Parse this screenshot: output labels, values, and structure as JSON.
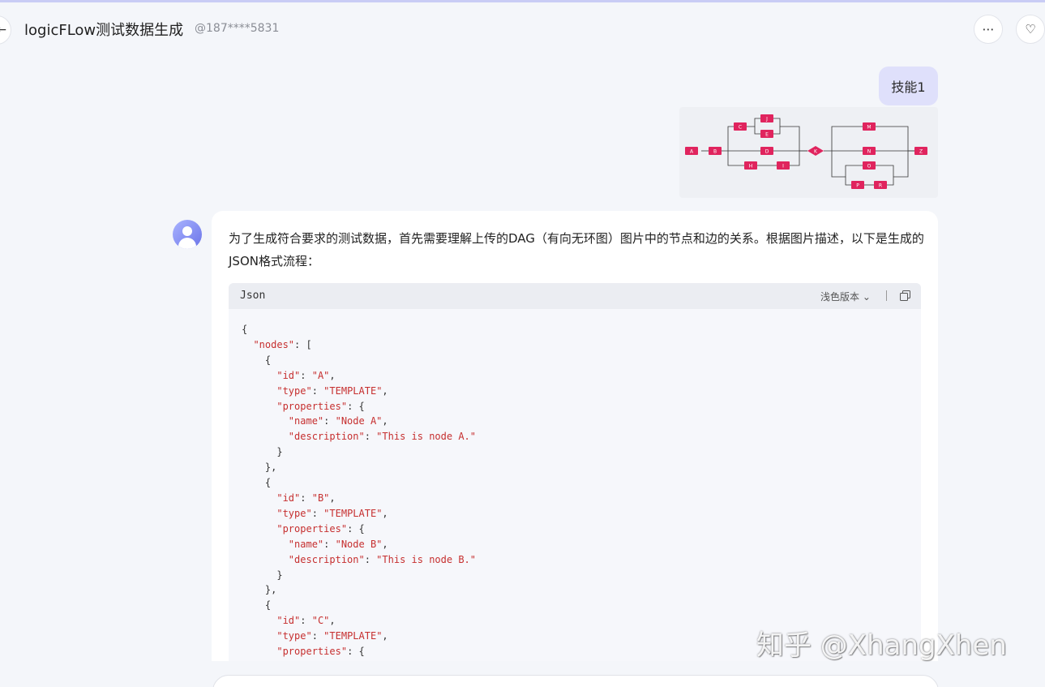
{
  "header": {
    "title": "logicFLow测试数据生成",
    "user_id": "@187****5831",
    "back_icon": "←",
    "more_icon": "⋯",
    "favorite_icon": "♡"
  },
  "user_message": {
    "text": "技能1"
  },
  "dag": {
    "nodes": [
      {
        "id": "A",
        "label": "A"
      },
      {
        "id": "B",
        "label": "B"
      },
      {
        "id": "C",
        "label": "C"
      },
      {
        "id": "J",
        "label": "J"
      },
      {
        "id": "E",
        "label": "E"
      },
      {
        "id": "D",
        "label": "D"
      },
      {
        "id": "H",
        "label": "H"
      },
      {
        "id": "I",
        "label": "I"
      },
      {
        "id": "K",
        "label": "K"
      },
      {
        "id": "M",
        "label": "M"
      },
      {
        "id": "N",
        "label": "N"
      },
      {
        "id": "O",
        "label": "O"
      },
      {
        "id": "P",
        "label": "P"
      },
      {
        "id": "R",
        "label": "R"
      },
      {
        "id": "Z",
        "label": "Z"
      }
    ],
    "edges": [
      [
        "A",
        "B"
      ],
      [
        "B",
        "C"
      ],
      [
        "B",
        "D"
      ],
      [
        "B",
        "H"
      ],
      [
        "C",
        "J"
      ],
      [
        "C",
        "E"
      ],
      [
        "J",
        "K"
      ],
      [
        "E",
        "K"
      ],
      [
        "D",
        "K"
      ],
      [
        "H",
        "I"
      ],
      [
        "I",
        "K"
      ],
      [
        "K",
        "M"
      ],
      [
        "K",
        "N"
      ],
      [
        "K",
        "O"
      ],
      [
        "O",
        "P"
      ],
      [
        "P",
        "R"
      ],
      [
        "R",
        "Z"
      ],
      [
        "M",
        "Z"
      ],
      [
        "N",
        "Z"
      ]
    ],
    "node_color": "#e0245e"
  },
  "answer": {
    "text": "为了生成符合要求的测试数据，首先需要理解上传的DAG（有向无环图）图片中的节点和边的关系。根据图片描述，以下是生成的JSON格式流程：",
    "code_language": "Json",
    "theme_label": "浅色版本",
    "theme_chevron": "⌄",
    "code": [
      "{",
      "  \"nodes\": [",
      "    {",
      "      \"id\": \"A\",",
      "      \"type\": \"TEMPLATE\",",
      "      \"properties\": {",
      "        \"name\": \"Node A\",",
      "        \"description\": \"This is node A.\"",
      "      }",
      "    },",
      "    {",
      "      \"id\": \"B\",",
      "      \"type\": \"TEMPLATE\",",
      "      \"properties\": {",
      "        \"name\": \"Node B\",",
      "        \"description\": \"This is node B.\"",
      "      }",
      "    },",
      "    {",
      "      \"id\": \"C\",",
      "      \"type\": \"TEMPLATE\",",
      "      \"properties\": {"
    ]
  },
  "watermark": "知乎 @XhangXhen",
  "colors": {
    "accent_bubble": "#dfe0fb",
    "code_key": "#c62f2f",
    "background": "#f4f6fa"
  }
}
